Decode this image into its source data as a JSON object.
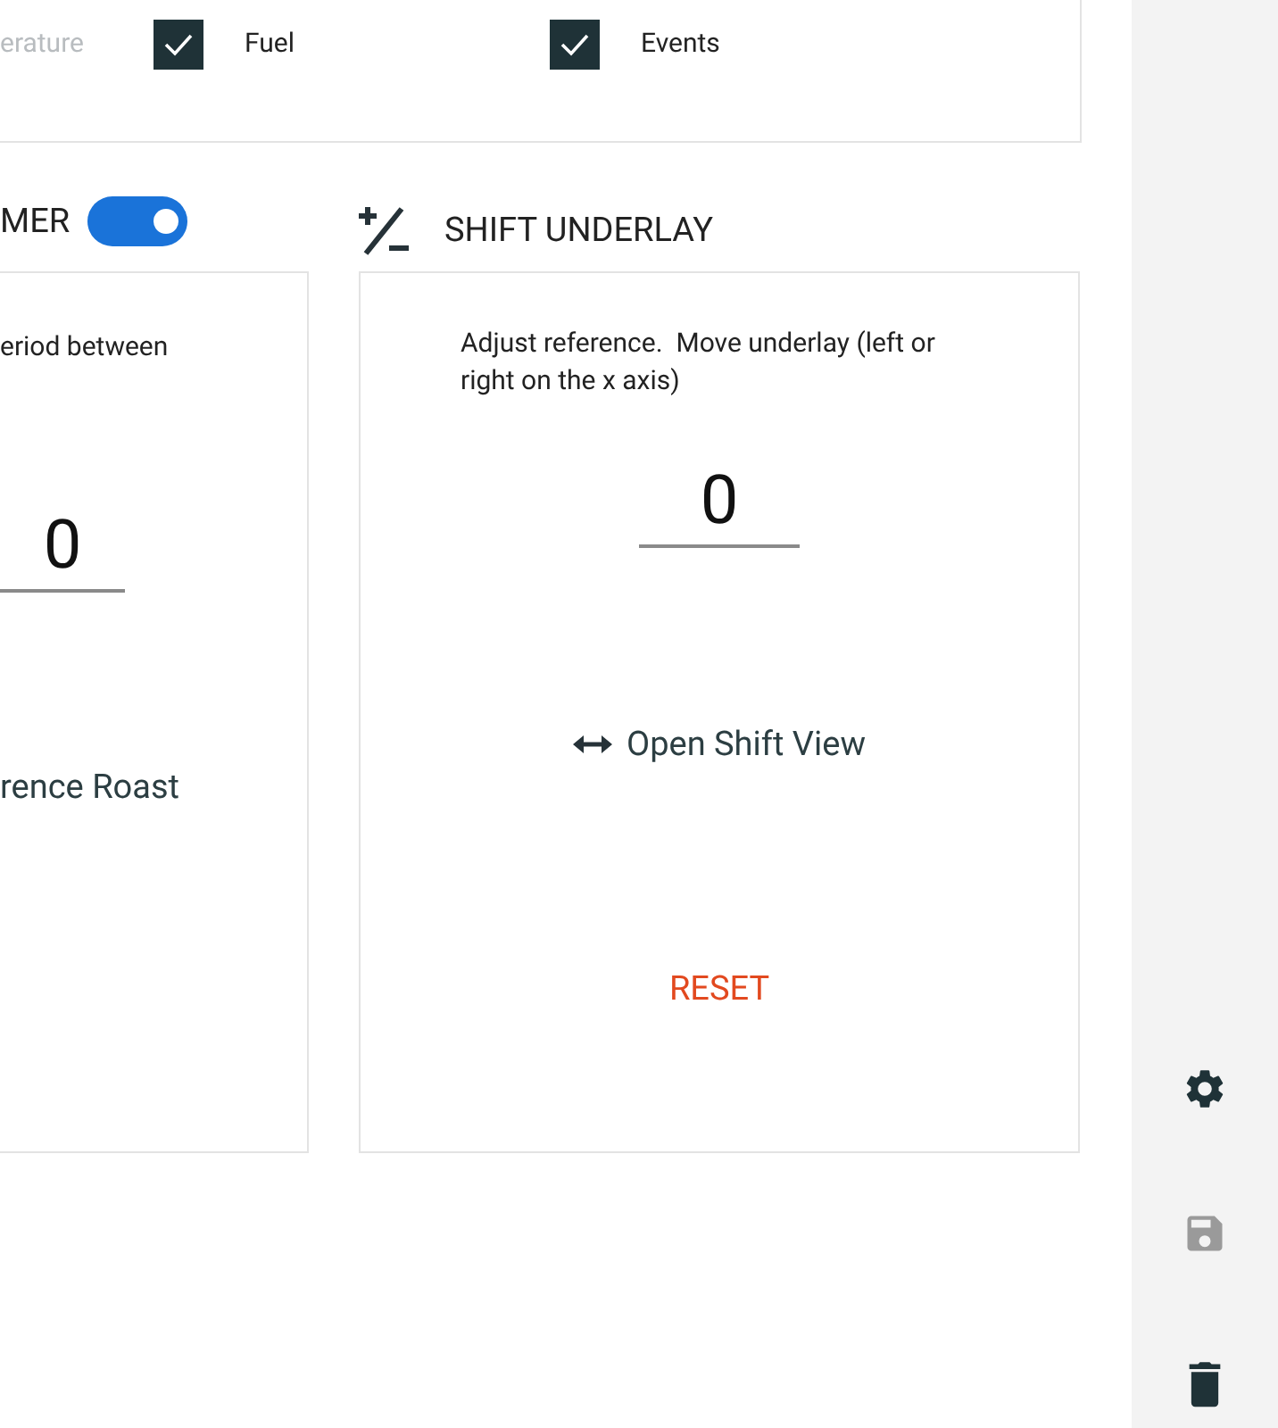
{
  "series_options": {
    "partial_label": {
      "text": "erature",
      "disabled": true
    },
    "options": [
      {
        "label": "Fuel",
        "checked": true
      },
      {
        "label": "Events",
        "checked": true
      }
    ]
  },
  "timer_card": {
    "title": "MER",
    "toggle_on": true,
    "description": "eriod between",
    "value": "0",
    "link": "rence Roast"
  },
  "shift_card": {
    "title": "SHIFT UNDERLAY",
    "description": "Adjust reference.  Move underlay (left or right on the x axis)",
    "value": "0",
    "link": "Open Shift View",
    "action": "RESET"
  },
  "sidebar": {
    "items": [
      {
        "kind": "settings",
        "disabled": false
      },
      {
        "kind": "save",
        "disabled": true
      },
      {
        "kind": "delete",
        "disabled": false
      }
    ]
  }
}
